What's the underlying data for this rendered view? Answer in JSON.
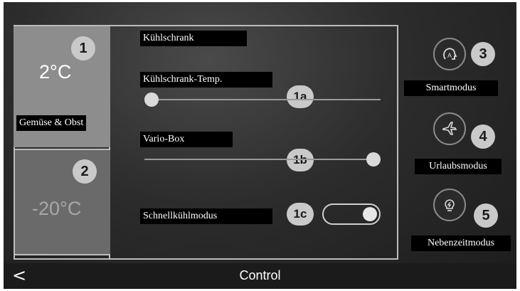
{
  "zones": [
    {
      "temp": "2°C",
      "callout": "1",
      "label": "Gemüse & Obst"
    },
    {
      "temp": "-20°C",
      "callout": "2"
    }
  ],
  "controls": {
    "fridge_label": "Kühlschrank",
    "fridge_temp_label": "Kühlschrank-Temp.",
    "fridge_temp_callout": "1a",
    "fridge_temp_level": 0.0,
    "vario_label": "Vario-Box",
    "vario_callout": "1b",
    "vario_level": 1.0,
    "quickcool_label": "Schnellkühlmodus",
    "quickcool_callout": "1c",
    "quickcool_on": true
  },
  "modes": [
    {
      "label": "Smartmodus",
      "callout": "3",
      "icon": "smart-mode-icon"
    },
    {
      "label": "Urlaubsmodus",
      "callout": "4",
      "icon": "airplane-icon"
    },
    {
      "label": "Nebenzeitmodus",
      "callout": "5",
      "icon": "lightbulb-icon"
    }
  ],
  "bottom_bar": {
    "back_icon": "<",
    "title": "Control"
  },
  "colors": {
    "fridge_zone": "#8d8d8d",
    "freezer_zone": "#6a6a6a",
    "callout": "#c9c9c9",
    "label_bg": "#000000"
  }
}
